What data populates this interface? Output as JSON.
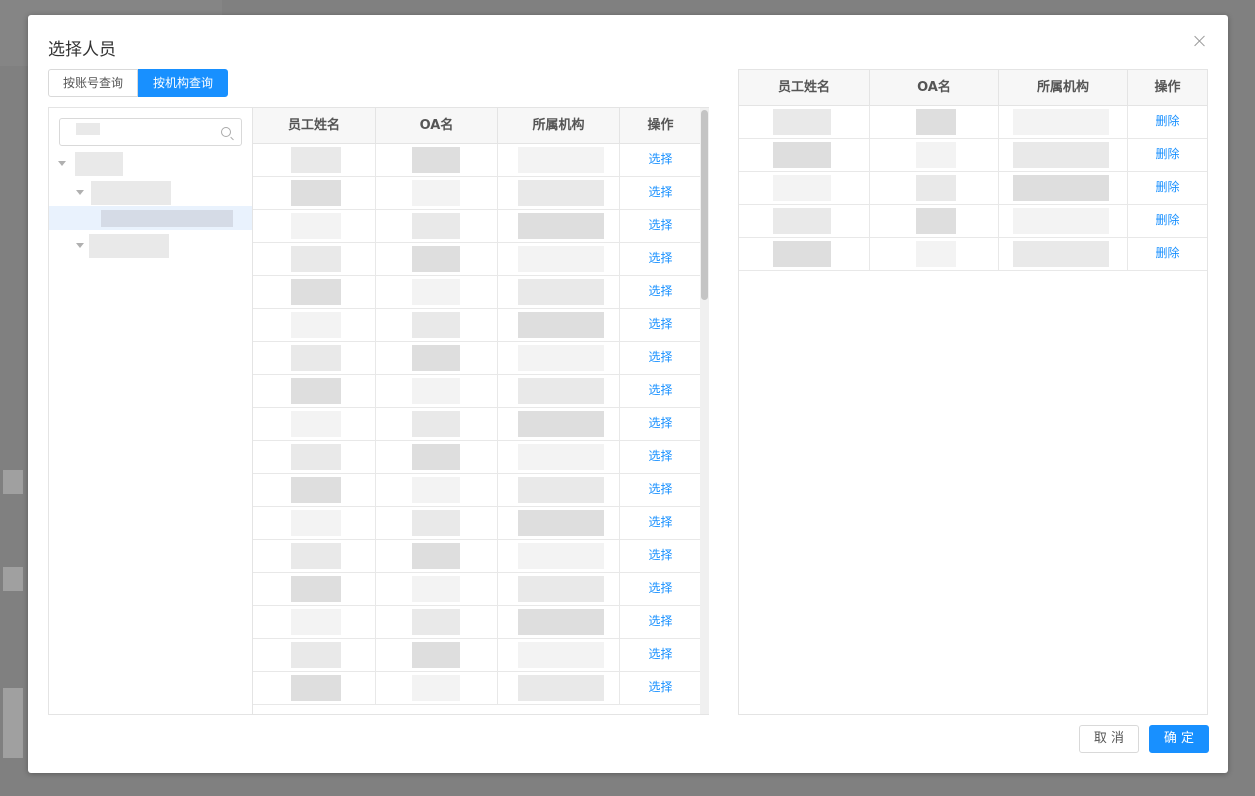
{
  "dialog": {
    "title": "选择人员",
    "close_icon": "close-icon"
  },
  "tabs": [
    {
      "label": "按账号查询",
      "active": false
    },
    {
      "label": "按机构查询",
      "active": true
    }
  ],
  "search": {
    "placeholder": ""
  },
  "left_table": {
    "columns": [
      "员工姓名",
      "OA名",
      "所属机构",
      "操作"
    ],
    "row_action": "选择",
    "row_count": 17
  },
  "right_table": {
    "columns": [
      "员工姓名",
      "OA名",
      "所属机构",
      "操作"
    ],
    "row_action": "删除",
    "row_count": 5
  },
  "footer": {
    "cancel_label": "取 消",
    "confirm_label": "确 定"
  },
  "colors": {
    "accent": "#1890ff",
    "header_bg": "#f7f7f7"
  }
}
